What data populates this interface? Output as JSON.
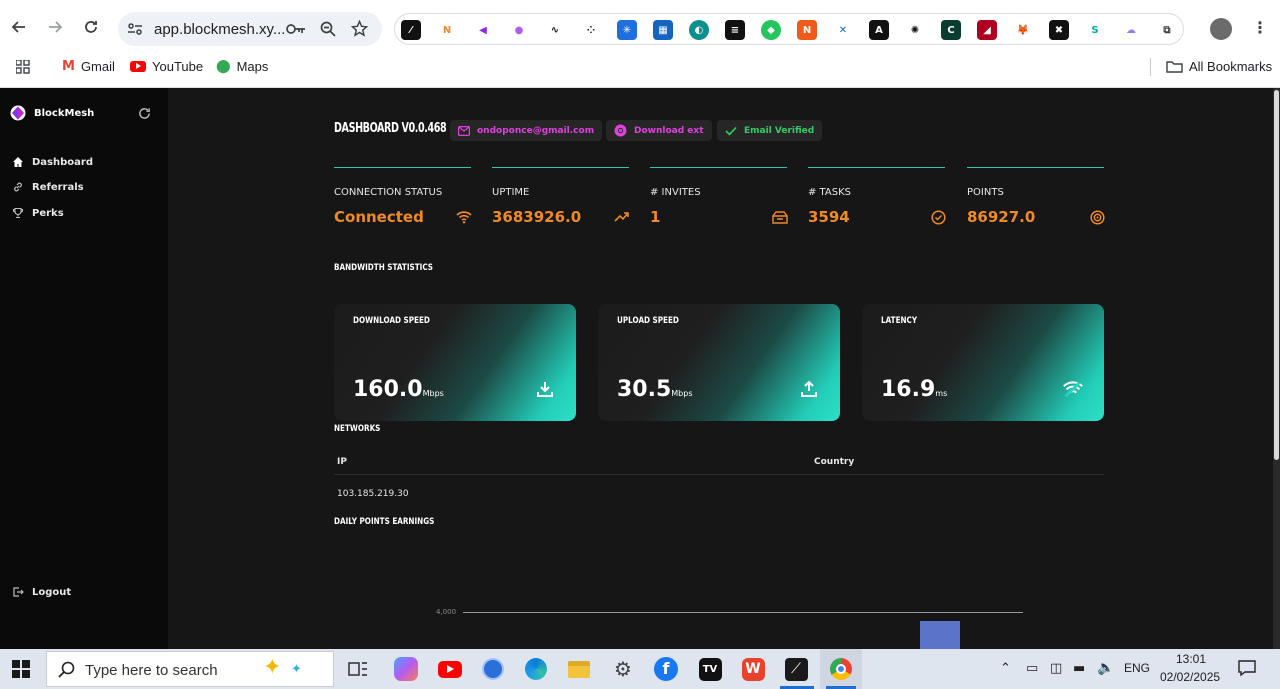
{
  "browser": {
    "url": "app.blockmesh.xy...",
    "bookmarks": [
      "Gmail",
      "YouTube",
      "Maps"
    ],
    "all_bookmarks": "All Bookmarks"
  },
  "sidebar": {
    "brand": "BlockMesh",
    "items": [
      {
        "label": "Dashboard",
        "icon": "home-icon"
      },
      {
        "label": "Referrals",
        "icon": "link-icon"
      },
      {
        "label": "Perks",
        "icon": "trophy-icon"
      }
    ],
    "logout": "Logout"
  },
  "header": {
    "title": "DASHBOARD V0.0.468",
    "email": "ondoponce@gmail.com",
    "download": "Download ext",
    "verified": "Email Verified"
  },
  "stats": [
    {
      "label": "CONNECTION STATUS",
      "value": "Connected",
      "icon": "wifi-icon"
    },
    {
      "label": "UPTIME",
      "value": "3683926.0",
      "icon": "trending-up-icon"
    },
    {
      "label": "# INVITES",
      "value": "1",
      "icon": "invites-icon"
    },
    {
      "label": "# TASKS",
      "value": "3594",
      "icon": "check-circle-icon"
    },
    {
      "label": "POINTS",
      "value": "86927.0",
      "icon": "target-icon"
    }
  ],
  "bandwidth": {
    "title": "BANDWIDTH STATISTICS",
    "cards": [
      {
        "title": "DOWNLOAD SPEED",
        "value": "160.0",
        "unit": "Mbps",
        "icon": "download-icon"
      },
      {
        "title": "UPLOAD SPEED",
        "value": "30.5",
        "unit": "Mbps",
        "icon": "upload-icon"
      },
      {
        "title": "LATENCY",
        "value": "16.9",
        "unit": "ms",
        "icon": "signal-icon"
      }
    ]
  },
  "networks": {
    "title": "NETWORKS",
    "columns": [
      "IP",
      "Country"
    ],
    "rows": [
      [
        "103.185.219.30",
        ""
      ]
    ]
  },
  "daily": {
    "title": "DAILY POINTS EARNINGS",
    "tick_label": "4,000"
  },
  "chart_data": {
    "type": "bar",
    "title": "",
    "y_ticks": [
      4000
    ],
    "visible_bar_value_above": 4000
  },
  "taskbar": {
    "search_placeholder": "Type here to search",
    "lang": "ENG",
    "time": "13:01",
    "date": "02/02/2025"
  },
  "colors": {
    "accent_orange": "#f08a24",
    "teal": "#2ec4b6",
    "pink": "#e040e0",
    "green": "#33cc66"
  }
}
